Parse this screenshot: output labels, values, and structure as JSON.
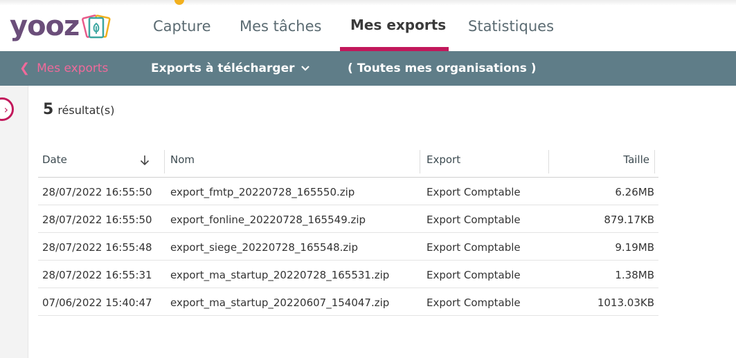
{
  "app": {
    "logo_text": "yooz",
    "nav": [
      "Capture",
      "Mes tâches",
      "Mes exports",
      "Statistiques"
    ],
    "active_nav": "Mes exports",
    "accent": "#c2185b",
    "subbar_bg": "#5f7d88"
  },
  "subbar": {
    "back_label": "Mes exports",
    "dropdown_label": "Exports à télécharger",
    "org_label": "( Toutes mes organisations )"
  },
  "results": {
    "count": "5",
    "label": "résultat(s)"
  },
  "table": {
    "columns": [
      "Date",
      "Nom",
      "Export",
      "Taille"
    ],
    "sort_icon": "arrow-down-icon",
    "rows": [
      [
        "28/07/2022 16:55:50",
        "export_fmtp_20220728_165550.zip",
        "Export Comptable",
        "6.26MB"
      ],
      [
        "28/07/2022 16:55:50",
        "export_fonline_20220728_165549.zip",
        "Export Comptable",
        "879.17KB"
      ],
      [
        "28/07/2022 16:55:48",
        "export_siege_20220728_165548.zip",
        "Export Comptable",
        "9.19MB"
      ],
      [
        "28/07/2022 16:55:31",
        "export_ma_startup_20220728_165531.zip",
        "Export Comptable",
        "1.38MB"
      ],
      [
        "07/06/2022 15:40:47",
        "export_ma_startup_20220607_154047.zip",
        "Export Comptable",
        "1013.03KB"
      ]
    ]
  }
}
